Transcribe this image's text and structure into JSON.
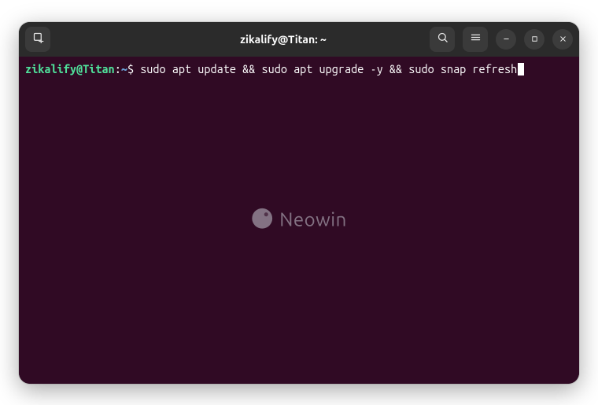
{
  "window": {
    "title": "zikalify@Titan: ~"
  },
  "titlebar": {
    "icons": {
      "newtab": "new-tab-icon",
      "search": "search-icon",
      "menu": "hamburger-menu-icon",
      "minimize": "minimize-icon",
      "maximize": "maximize-icon",
      "close": "close-icon"
    }
  },
  "terminal": {
    "prompt": {
      "user_host": "zikalify@Titan",
      "colon": ":",
      "path": "~",
      "symbol": "$"
    },
    "command": "sudo apt update && sudo apt upgrade -y && sudo snap refresh",
    "background_color": "#300a24"
  },
  "watermark": {
    "text": "Neowin",
    "icon": "neowin-logo-icon"
  }
}
